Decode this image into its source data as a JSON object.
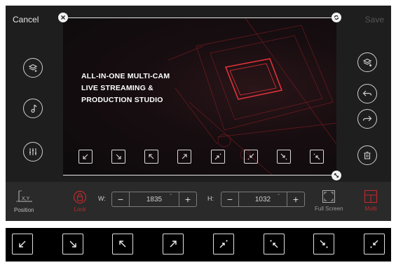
{
  "header": {
    "cancel_label": "Cancel",
    "save_label": "Save"
  },
  "canvas": {
    "headline": [
      "ALL-IN-ONE MULTI-CAM",
      "LIVE STREAMING &",
      "PRODUCTION STUDIO"
    ]
  },
  "left_tools": [
    "layers-add-icon",
    "music-note-icon",
    "equalizer-icon"
  ],
  "right_tools": [
    "layers-settings-icon",
    "undo-icon",
    "redo-icon",
    "trash-icon"
  ],
  "position_arrows": [
    "down-left",
    "down-right",
    "up-left",
    "up-right",
    "to-up-right",
    "to-down-left",
    "to-down-right",
    "to-up-left"
  ],
  "bottom_strip_arrows": [
    "down-left",
    "down-right",
    "up-left",
    "up-right",
    "to-up-right",
    "to-down-left",
    "to-down-right",
    "to-up-left"
  ],
  "toolbar": {
    "position_label": "Position",
    "lock_label": "Lock",
    "width_label": "W:",
    "width_value": "1835",
    "height_label": "H:",
    "height_value": "1032",
    "fullscreen_label": "Full Screen",
    "multi_label": "Multi",
    "accent": "#c0282d"
  }
}
